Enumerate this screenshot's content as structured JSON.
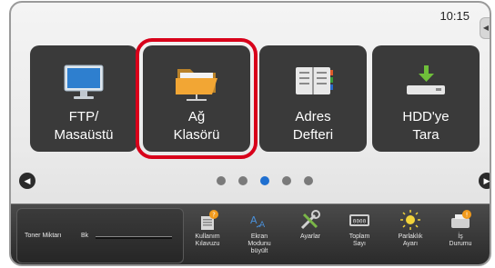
{
  "status": {
    "time": "10:15",
    "side_tab_glyph": "◀"
  },
  "tiles": [
    {
      "line1": "FTP/",
      "line2": "Masaüstü",
      "icon": "monitor-icon"
    },
    {
      "line1": "Ağ",
      "line2": "Klasörü",
      "icon": "folder-icon",
      "selected": true
    },
    {
      "line1": "Adres",
      "line2": "Defteri",
      "icon": "address-book-icon"
    },
    {
      "line1": "HDD'ye",
      "line2": "Tara",
      "icon": "hdd-download-icon"
    }
  ],
  "nav": {
    "left": "◀",
    "right": "▶",
    "pages": 5,
    "active_page": 3
  },
  "bottom": {
    "toner_label": "Toner Miktarı",
    "toner_channel": "Bk",
    "items": [
      {
        "lines": [
          "Kullanım",
          "Kılavuzu"
        ],
        "icon": "manual-icon"
      },
      {
        "lines": [
          "Ekran",
          "Modunu",
          "büyült"
        ],
        "icon": "magnify-text-icon"
      },
      {
        "lines": [
          "Ayarlar"
        ],
        "icon": "tools-icon"
      },
      {
        "lines": [
          "Toplam",
          "Sayı"
        ],
        "icon": "counter-icon"
      },
      {
        "lines": [
          "Parlaklık",
          "Ayarı"
        ],
        "icon": "brightness-icon"
      },
      {
        "lines": [
          "İş",
          "Durumu"
        ],
        "icon": "job-status-icon"
      }
    ]
  },
  "colors": {
    "selection": "#d8001a",
    "active_dot": "#1f6fd0",
    "tile_bg": "#3a3a3a"
  }
}
